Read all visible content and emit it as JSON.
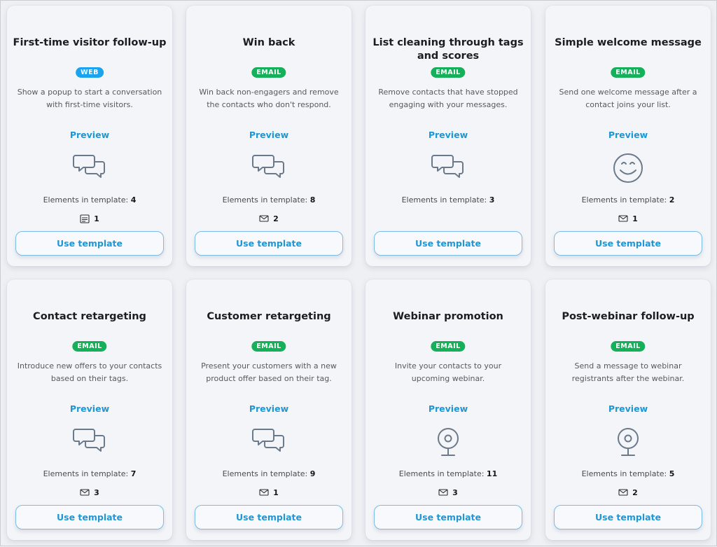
{
  "templates": [
    {
      "title": "First-time visitor follow-up",
      "badge": "WEB",
      "badge_color": "#1aa3ee",
      "description": "Show a popup to start a conversation with first-time visitors.",
      "preview_label": "Preview",
      "icon": "chat-bubbles-icon",
      "elements_label": "Elements in template:",
      "elements_count": "4",
      "meta_icon": "popup-form-icon",
      "meta_count": "1",
      "button_label": "Use template"
    },
    {
      "title": "Win back",
      "badge": "EMAIL",
      "badge_color": "#16b05a",
      "description": "Win back non-engagers and remove the contacts who don't respond.",
      "preview_label": "Preview",
      "icon": "chat-bubbles-icon",
      "elements_label": "Elements in template:",
      "elements_count": "8",
      "meta_icon": "envelope-icon",
      "meta_count": "2",
      "button_label": "Use template"
    },
    {
      "title": "List cleaning through tags and scores",
      "badge": "EMAIL",
      "badge_color": "#16b05a",
      "description": "Remove contacts that have stopped engaging with your messages.",
      "preview_label": "Preview",
      "icon": "chat-bubbles-icon",
      "elements_label": "Elements in template:",
      "elements_count": "3",
      "meta_icon": "",
      "meta_count": "",
      "button_label": "Use template"
    },
    {
      "title": "Simple welcome message",
      "badge": "EMAIL",
      "badge_color": "#16b05a",
      "description": "Send one welcome message after a contact joins your list.",
      "preview_label": "Preview",
      "icon": "smiley-icon",
      "elements_label": "Elements in template:",
      "elements_count": "2",
      "meta_icon": "envelope-icon",
      "meta_count": "1",
      "button_label": "Use template"
    },
    {
      "title": "Contact retargeting",
      "badge": "EMAIL",
      "badge_color": "#16b05a",
      "description": "Introduce new offers to your contacts based on their tags.",
      "preview_label": "Preview",
      "icon": "chat-bubbles-icon",
      "elements_label": "Elements in template:",
      "elements_count": "7",
      "meta_icon": "envelope-icon",
      "meta_count": "3",
      "button_label": "Use template"
    },
    {
      "title": "Customer retargeting",
      "badge": "EMAIL",
      "badge_color": "#16b05a",
      "description": "Present your customers with a new product offer based on their tag.",
      "preview_label": "Preview",
      "icon": "chat-bubbles-icon",
      "elements_label": "Elements in template:",
      "elements_count": "9",
      "meta_icon": "envelope-icon",
      "meta_count": "1",
      "button_label": "Use template"
    },
    {
      "title": "Webinar promotion",
      "badge": "EMAIL",
      "badge_color": "#16b05a",
      "description": "Invite your contacts to your upcoming webinar.",
      "preview_label": "Preview",
      "icon": "webcam-icon",
      "elements_label": "Elements in template:",
      "elements_count": "11",
      "meta_icon": "envelope-icon",
      "meta_count": "3",
      "button_label": "Use template"
    },
    {
      "title": "Post-webinar follow-up",
      "badge": "EMAIL",
      "badge_color": "#16b05a",
      "description": "Send a message to webinar registrants after the webinar.",
      "preview_label": "Preview",
      "icon": "webcam-icon",
      "elements_label": "Elements in template:",
      "elements_count": "5",
      "meta_icon": "envelope-icon",
      "meta_count": "2",
      "button_label": "Use template"
    }
  ],
  "colors": {
    "accent": "#1e97d6",
    "icon_stroke": "#6a7a8a",
    "web_badge": "#1aa3ee",
    "email_badge": "#16b05a"
  }
}
